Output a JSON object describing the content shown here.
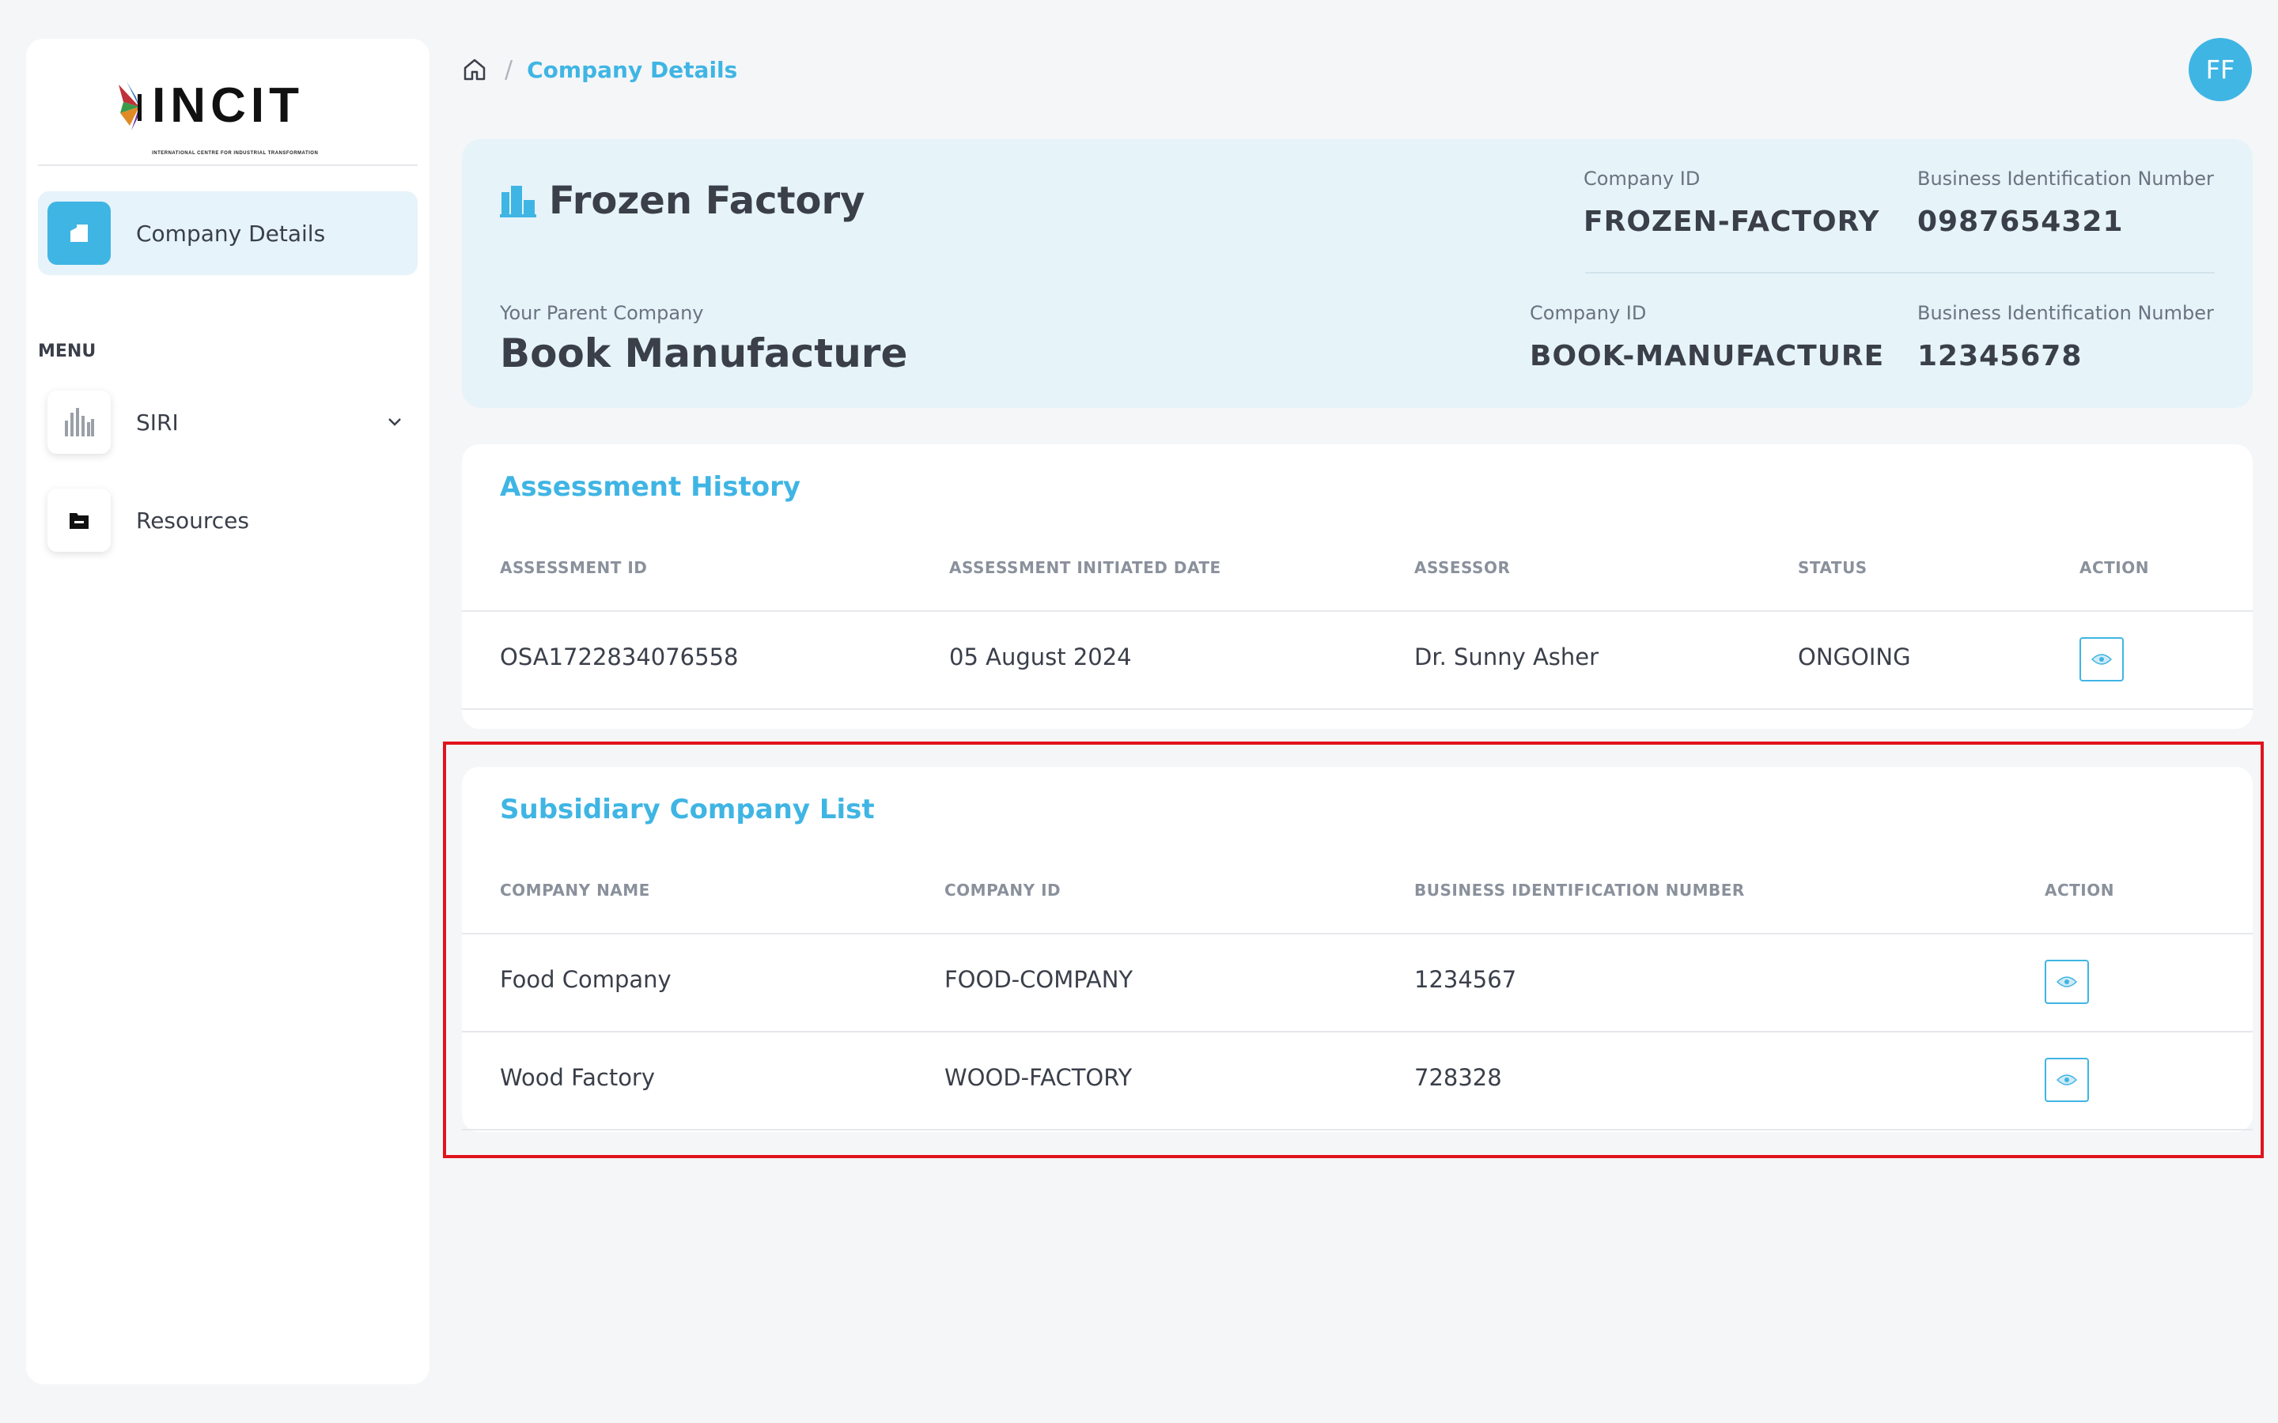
{
  "sidebar": {
    "logo_text": "INCIT",
    "logo_subtitle": "INTERNATIONAL CENTRE FOR INDUSTRIAL TRANSFORMATION",
    "active_item": {
      "label": "Company Details",
      "icon": "building-icon"
    },
    "menu_heading": "MENU",
    "items": [
      {
        "label": "SIRI",
        "icon": "bar-chart-icon",
        "has_submenu": true
      },
      {
        "label": "Resources",
        "icon": "folder-icon",
        "has_submenu": false
      }
    ]
  },
  "breadcrumb": {
    "home_icon": "home-icon",
    "separator": "/",
    "current": "Company Details"
  },
  "user": {
    "initials": "FF"
  },
  "company": {
    "name": "Frozen Factory",
    "id_label": "Company ID",
    "id": "FROZEN-FACTORY",
    "bin_label": "Business Identification Number",
    "bin": "0987654321",
    "parent_label": "Your Parent Company",
    "parent_name": "Book Manufacture",
    "parent_id_label": "Company ID",
    "parent_id": "BOOK-MANUFACTURE",
    "parent_bin_label": "Business Identification Number",
    "parent_bin": "12345678"
  },
  "assessment_history": {
    "title": "Assessment History",
    "columns": [
      "ASSESSMENT ID",
      "ASSESSMENT INITIATED DATE",
      "ASSESSOR",
      "STATUS",
      "ACTION"
    ],
    "rows": [
      {
        "id": "OSA1722834076558",
        "date": "05 August 2024",
        "assessor": "Dr. Sunny Asher",
        "status": "ONGOING"
      }
    ]
  },
  "subsidiaries": {
    "title": "Subsidiary Company List",
    "columns": [
      "COMPANY NAME",
      "COMPANY ID",
      "BUSINESS IDENTIFICATION NUMBER",
      "ACTION"
    ],
    "rows": [
      {
        "name": "Food Company",
        "id": "FOOD-COMPANY",
        "bin": "1234567"
      },
      {
        "name": "Wood Factory",
        "id": "WOOD-FACTORY",
        "bin": "728328"
      }
    ]
  },
  "colors": {
    "accent": "#3fb5e4",
    "card_bg": "#e6f3f9",
    "highlight": "#e0141e"
  }
}
